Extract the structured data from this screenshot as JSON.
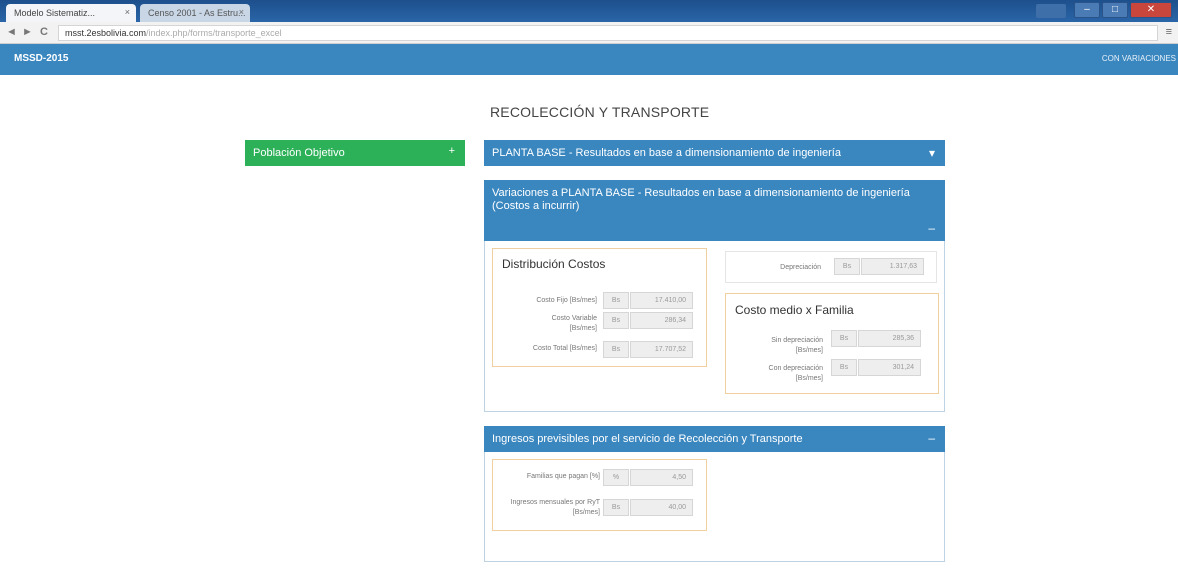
{
  "browser": {
    "tabs": [
      {
        "label": "Modelo Sistematiz...",
        "close": "×"
      },
      {
        "label": "Censo 2001 - As Estru...",
        "close": "×"
      }
    ],
    "url_host": "msst.2esbolivia.com",
    "url_rest": "/index.php/forms/transporte_excel",
    "nav": {
      "back": "◄",
      "forward": "►",
      "reload": "C"
    },
    "window_controls": {
      "minimize": "–",
      "maximize": "□",
      "close": "✕"
    },
    "menu": "≡"
  },
  "navbar": {
    "brand": "MSSD-2015",
    "link": "CON VARIACIONES"
  },
  "page": {
    "title": "RECOLECCIÓN Y TRANSPORTE"
  },
  "left_panel": {
    "label": "Población Objetivo",
    "chevron": "+"
  },
  "panel_base": {
    "title": "PLANTA BASE - Resultados en base a dimensionamiento de ingeniería",
    "chevron": "▾"
  },
  "panel_variaciones": {
    "title": "Variaciones a PLANTA BASE - Resultados en base a dimensionamiento de ingeniería (Costos a incurrir)",
    "chevron": "–",
    "distribucion": {
      "title": "Distribución Costos",
      "rows": [
        {
          "label": "Costo Fijo [Bs/mes]",
          "currency": "Bs",
          "value": "17.410,00"
        },
        {
          "label": "Costo Variable [Bs/mes]",
          "currency": "Bs",
          "value": "286,34"
        },
        {
          "label": "Costo Total [Bs/mes]",
          "currency": "Bs",
          "value": "17.707,52"
        }
      ]
    },
    "depreciacion": {
      "label": "Depreciación",
      "currency": "Bs",
      "value": "1.317,63"
    },
    "costo_medio": {
      "title": "Costo medio x Familia",
      "rows": [
        {
          "label": "Sin depreciación [Bs/mes]",
          "currency": "Bs",
          "value": "285,36"
        },
        {
          "label": "Con depreciación [Bs/mes]",
          "currency": "Bs",
          "value": "301,24"
        }
      ]
    }
  },
  "panel_ingresos": {
    "title": "Ingresos previsibles por el servicio de Recolección y Transporte",
    "chevron": "–",
    "rows": [
      {
        "label": "Familias que pagan [%]",
        "currency": "%",
        "value": "4,50"
      },
      {
        "label": "Ingresos mensuales por RyT [Bs/mes]",
        "currency": "Bs",
        "value": "40,00"
      }
    ]
  },
  "colors": {
    "navbar": "#3a87c0",
    "panel_header": "#3a87c0",
    "green": "#2cb159",
    "group_border": "#f0cfa1"
  }
}
